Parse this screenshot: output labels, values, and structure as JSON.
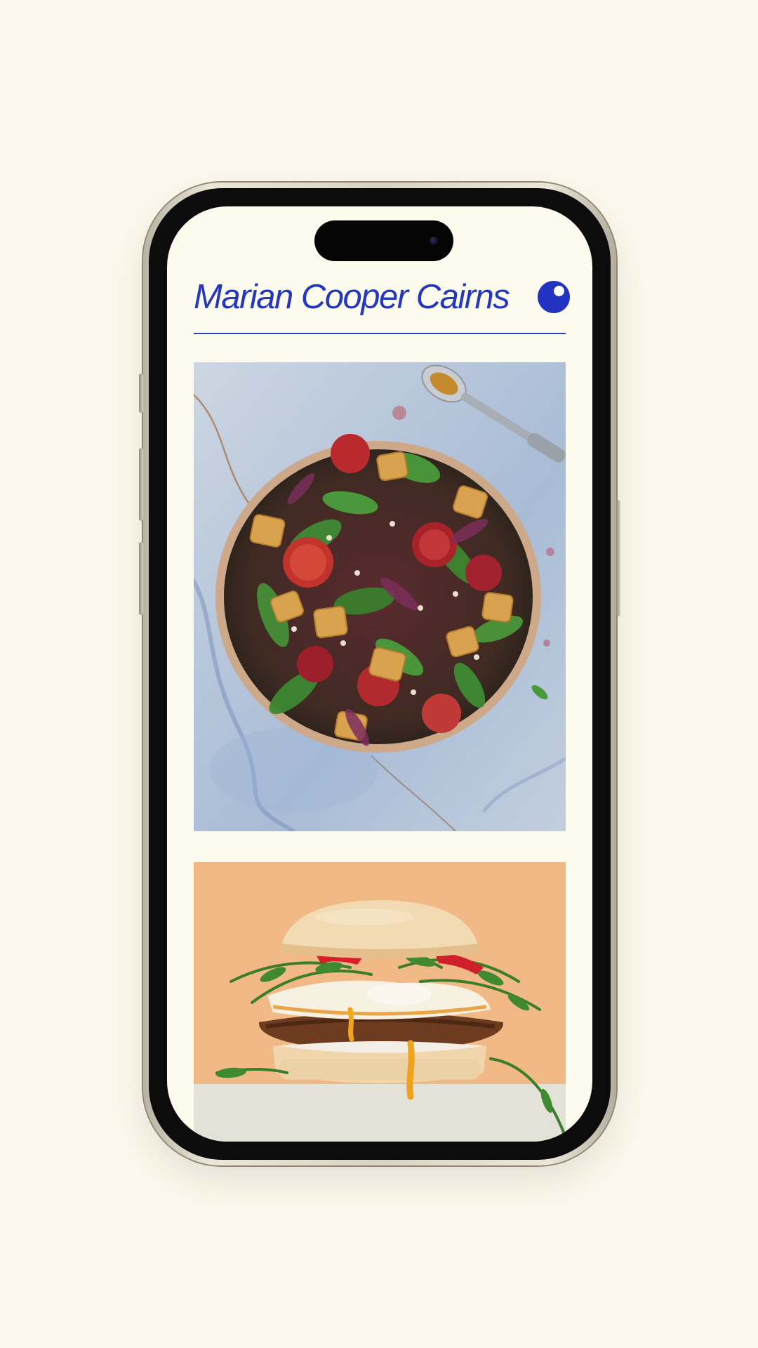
{
  "site": {
    "title": "Marian Cooper Cairns"
  },
  "icons": {
    "brand_dot": "blue-circle-logo-icon"
  },
  "feed": {
    "items": [
      {
        "kind": "photo",
        "subject": "salad-bowl"
      },
      {
        "kind": "photo",
        "subject": "breakfast-sandwich"
      }
    ]
  },
  "colors": {
    "page_background": "#fcf9ec",
    "screen_background": "#fdfaee",
    "accent_blue": "#2437c0",
    "divider_blue": "#2b3fc4"
  }
}
